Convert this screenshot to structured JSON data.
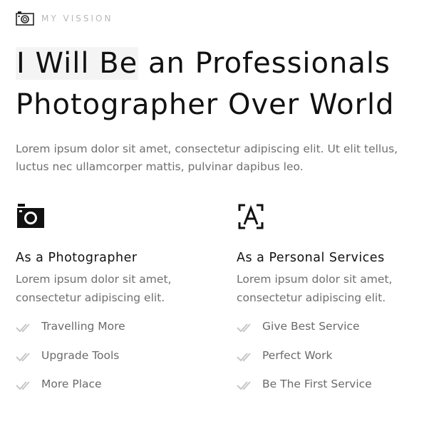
{
  "eyebrow": {
    "icon": "camera-icon",
    "label": "MY VISSION"
  },
  "headline": {
    "highlighted": "I Will Be",
    "rest": " an Professionals Photographer Over World"
  },
  "intro": "Lorem ipsum dolor sit amet, consectetur adipiscing elit. Ut elit tellus, luctus nec ullamcorper mattis, pulvinar dapibus leo.",
  "features": [
    {
      "icon": "camera-icon",
      "title": "As a Photographer",
      "desc": "Lorem ipsum dolor sit amet, consectetur adipiscing elit.",
      "items": [
        "Travelling More",
        "Upgrade Tools",
        "More Place"
      ]
    },
    {
      "icon": "font-icon",
      "title": "As a Personal Services",
      "desc": "Lorem ipsum dolor sit amet, consectetur adipiscing elit.",
      "items": [
        "Give Best Service",
        "Perfect Work",
        "Be The First Service"
      ]
    }
  ],
  "colors": {
    "text": "#111111",
    "muted": "#6f6f6f",
    "eyebrow": "#b9b9b9",
    "check": "#c7c7c7",
    "highlight": "#f4f4f4"
  }
}
